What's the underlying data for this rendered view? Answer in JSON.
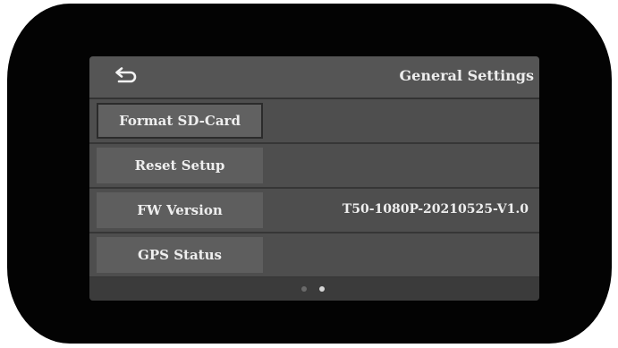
{
  "header": {
    "title": "General Settings",
    "back_icon": "return-arrow-icon"
  },
  "menu": {
    "items": [
      {
        "label": "Format SD-Card",
        "value": "",
        "selected": true
      },
      {
        "label": "Reset Setup",
        "value": ""
      },
      {
        "label": "FW Version",
        "value": "T50-1080P-20210525-V1.0"
      },
      {
        "label": "GPS Status",
        "value": ""
      }
    ]
  },
  "pagination": {
    "pages": 2,
    "current": 2
  },
  "colors": {
    "bezel": "#030303",
    "screen_bg": "#3b3b3b",
    "header_bg": "#555555",
    "row_bg": "#4e4e4e",
    "button_bg": "#5e5e5e",
    "text": "#eeeeee"
  }
}
